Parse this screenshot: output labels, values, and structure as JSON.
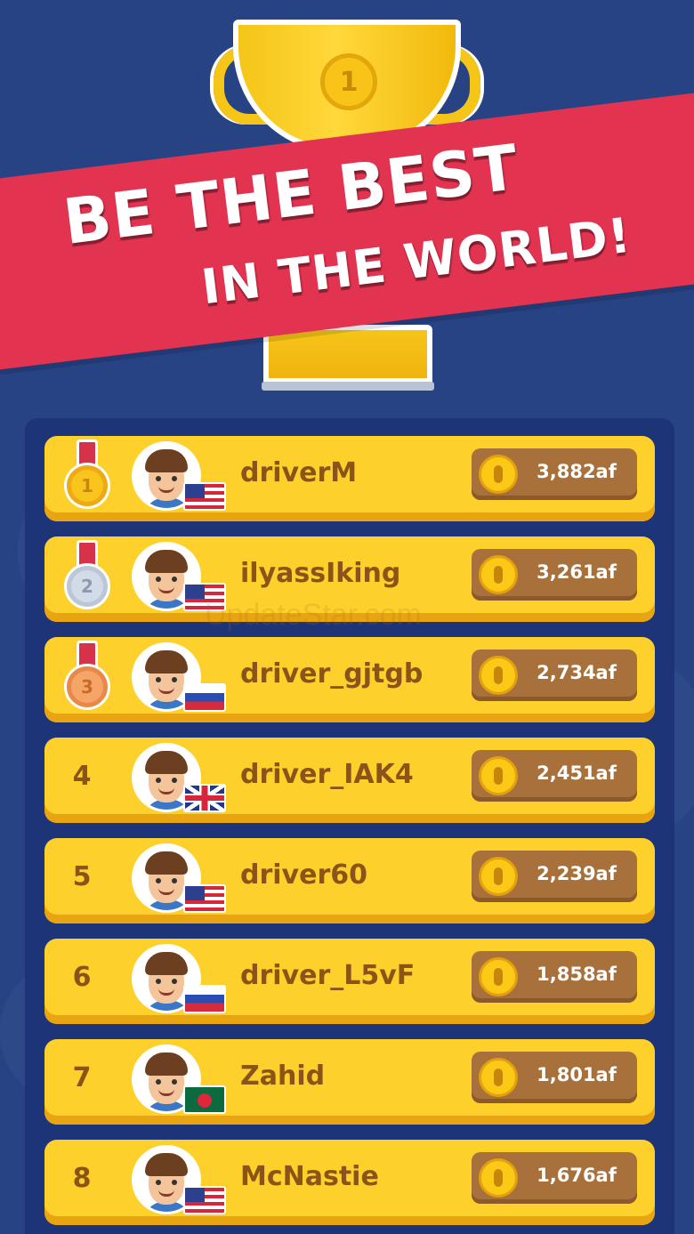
{
  "banner": {
    "line1": "BE THE BEST",
    "line2": "IN THE WORLD!"
  },
  "trophy": {
    "badge_number": "1"
  },
  "watermark": "UpdateStar.com",
  "leaderboard": [
    {
      "rank": "1",
      "medal": "gold",
      "name": "driverM",
      "flag": "us",
      "score": "3,882af"
    },
    {
      "rank": "2",
      "medal": "silver",
      "name": "ilyassIking",
      "flag": "us",
      "score": "3,261af"
    },
    {
      "rank": "3",
      "medal": "bronze",
      "name": "driver_gjtgb",
      "flag": "ru",
      "score": "2,734af"
    },
    {
      "rank": "4",
      "medal": "",
      "name": "driver_IAK4",
      "flag": "gb",
      "score": "2,451af"
    },
    {
      "rank": "5",
      "medal": "",
      "name": "driver60",
      "flag": "us",
      "score": "2,239af"
    },
    {
      "rank": "6",
      "medal": "",
      "name": "driver_L5vF",
      "flag": "ru",
      "score": "1,858af"
    },
    {
      "rank": "7",
      "medal": "",
      "name": "Zahid",
      "flag": "bd",
      "score": "1,801af"
    },
    {
      "rank": "8",
      "medal": "",
      "name": "McNastie",
      "flag": "us",
      "score": "1,676af"
    }
  ]
}
